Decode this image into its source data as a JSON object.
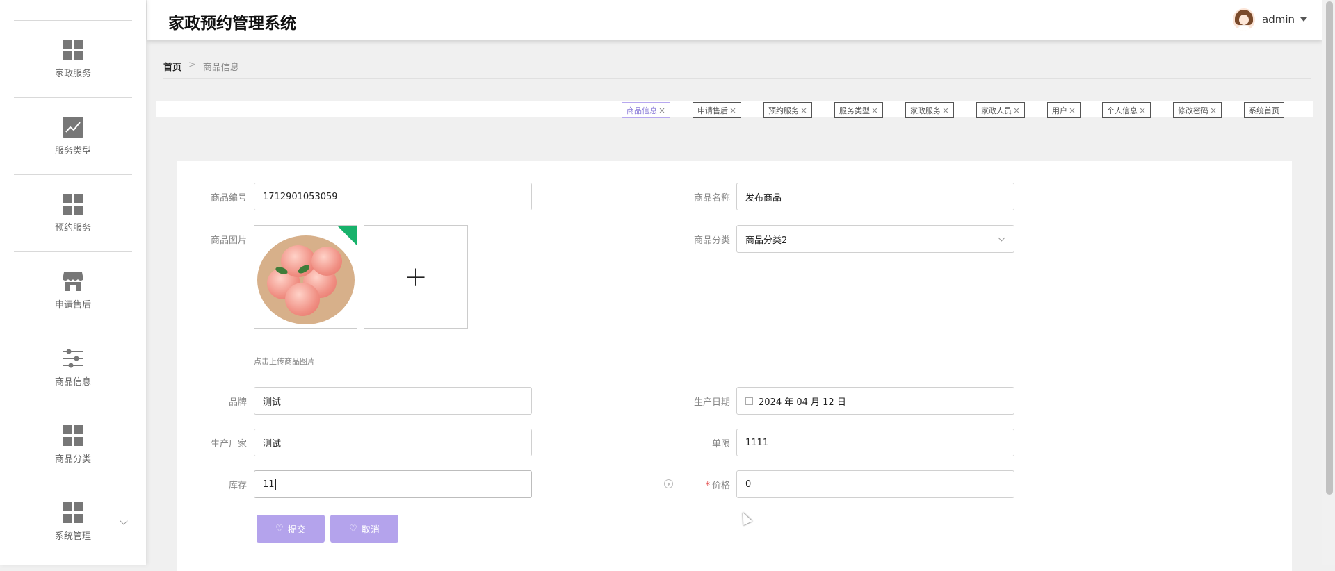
{
  "header": {
    "title": "家政预约管理系统",
    "user": "admin"
  },
  "sidebar": {
    "items": [
      {
        "label": "家政服务",
        "icon": "grid-icon"
      },
      {
        "label": "服务类型",
        "icon": "chart-icon"
      },
      {
        "label": "预约服务",
        "icon": "grid-icon"
      },
      {
        "label": "申请售后",
        "icon": "store-icon"
      },
      {
        "label": "商品信息",
        "icon": "sliders-icon"
      },
      {
        "label": "商品分类",
        "icon": "grid-icon"
      },
      {
        "label": "系统管理",
        "icon": "grid-icon"
      }
    ]
  },
  "breadcrumb": {
    "home": "首页",
    "separator": ">",
    "current": "商品信息"
  },
  "tags": [
    {
      "label": "商品信息",
      "close": "×",
      "active": true
    },
    {
      "label": "申请售后",
      "close": "×"
    },
    {
      "label": "预约服务",
      "close": "×"
    },
    {
      "label": "服务类型",
      "close": "×"
    },
    {
      "label": "家政服务",
      "close": "×"
    },
    {
      "label": "家政人员",
      "close": "×"
    },
    {
      "label": "用户",
      "close": "×"
    },
    {
      "label": "个人信息",
      "close": "×"
    },
    {
      "label": "修改密码",
      "close": "×"
    },
    {
      "label": "系统首页",
      "close": ""
    }
  ],
  "form": {
    "product_no": {
      "label": "商品编号",
      "value": "1712901053059"
    },
    "product_name": {
      "label": "商品名称",
      "value": "发布商品"
    },
    "product_image": {
      "label": "商品图片",
      "hint": "点击上传商品图片",
      "add": "+"
    },
    "category": {
      "label": "商品分类",
      "value": "商品分类2"
    },
    "brand": {
      "label": "品牌",
      "value": "测试"
    },
    "production_date": {
      "label": "生产日期",
      "value": "2024 年 04 月 12 日"
    },
    "manufacturer": {
      "label": "生产厂家",
      "value": "测试"
    },
    "limit": {
      "label": "单限",
      "value": "1111"
    },
    "stock": {
      "label": "库存",
      "value": "11"
    },
    "price": {
      "label": "价格",
      "required": "*",
      "value": "0"
    }
  },
  "buttons": {
    "submit": "提交",
    "cancel": "取消",
    "icon": "heart-icon"
  },
  "colors": {
    "accent": "#b4a3ec",
    "tag_active": "#8a7bd8",
    "badge": "#18b26b"
  }
}
